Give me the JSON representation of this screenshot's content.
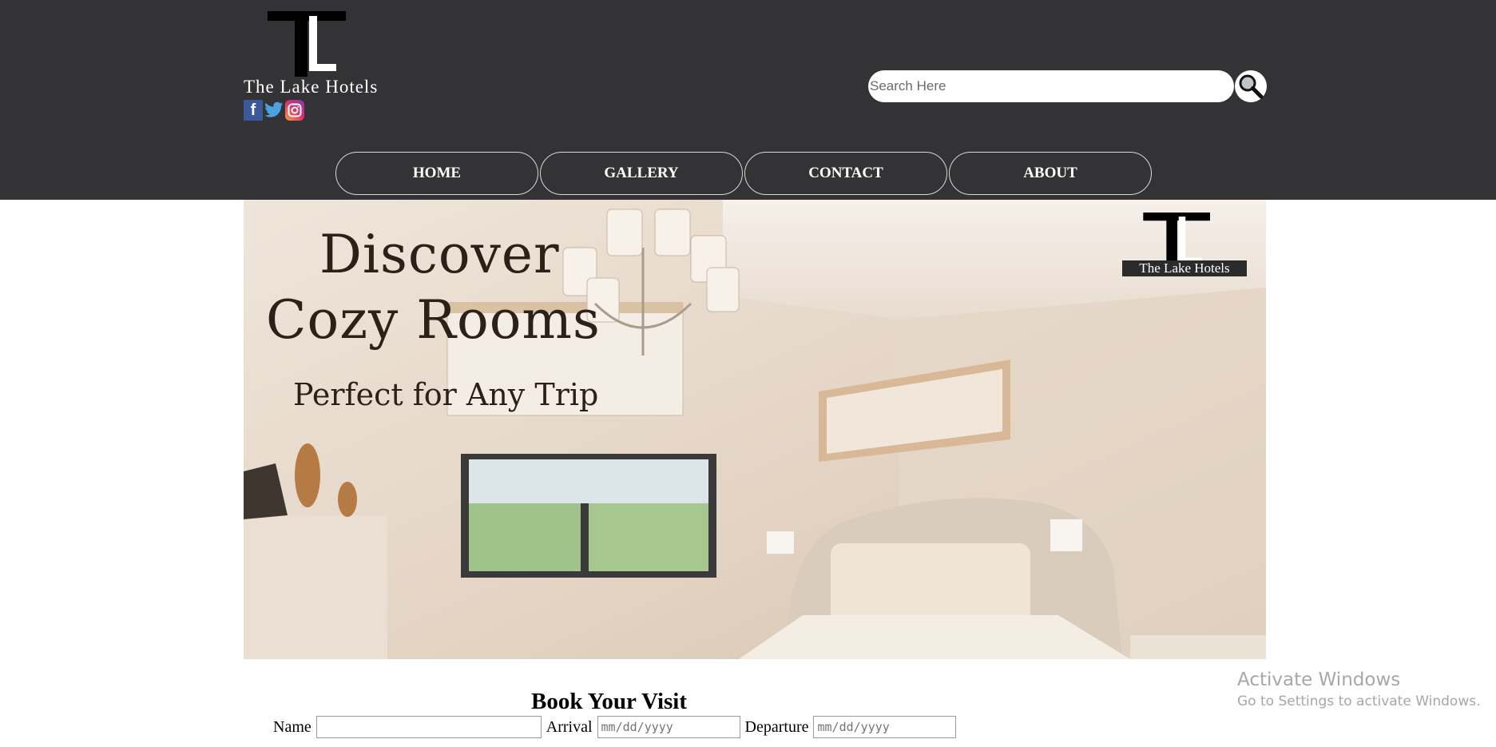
{
  "header": {
    "logo_text": "The Lake Hotels",
    "logo_lettering": "TL",
    "social": [
      {
        "name": "facebook",
        "glyph": "f"
      },
      {
        "name": "twitter",
        "glyph": ""
      },
      {
        "name": "instagram",
        "glyph": ""
      }
    ],
    "search_placeholder": "Search Here",
    "nav": [
      "HOME",
      "GALLERY",
      "CONTACT",
      "ABOUT"
    ]
  },
  "hero": {
    "line1": "Discover",
    "line2": "Cozy Rooms",
    "line3": "Perfect for Any Trip",
    "logo_text": "The Lake Hotels"
  },
  "booking": {
    "title": "Book Your Visit",
    "name_label": "Name",
    "arrival_label": "Arrival",
    "departure_label": "Departure",
    "date_placeholder": "mm/dd/yyyy"
  },
  "watermark": {
    "line1": "Activate Windows",
    "line2": "Go to Settings to activate Windows."
  },
  "colors": {
    "header_bg": "#333335",
    "nav_border": "#d8d8d8"
  }
}
